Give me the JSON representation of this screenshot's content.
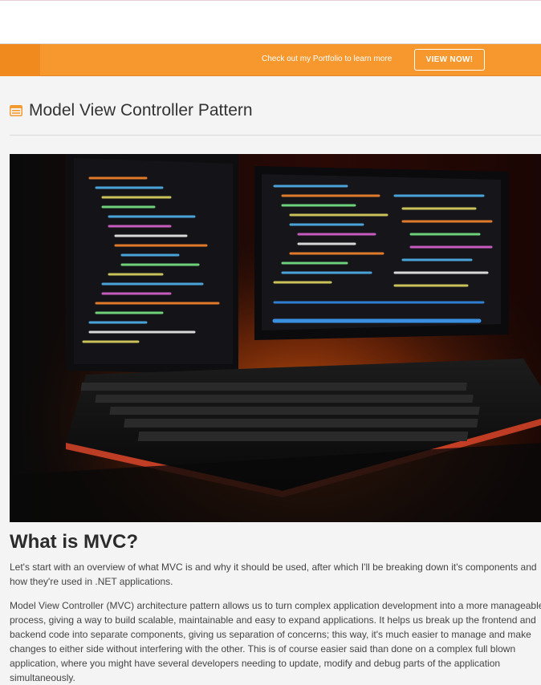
{
  "promo": {
    "text": "Check out my Portfolio to learn more",
    "button_label": "VIEW NOW!"
  },
  "article": {
    "title": "Model View Controller Pattern",
    "title_icon": "article-icon",
    "hero_image": "monitors-and-keyboard-with-code",
    "section_heading": "What is MVC?",
    "paragraphs": [
      "Let's start with an overview of what MVC is and why it should be used, after which I'll be breaking down it's components and how they're used in .NET applications.",
      "Model View Controller (MVC) architecture pattern allows us to turn complex application development into a more manageable process, giving a way to build scalable, maintainable and easy to expand applications. It helps us break up the frontend and backend code into separate components, giving us separation of concerns; this way, it's much easier to manage and make changes to either side without interfering with the other. This is of course easier said than done on a complex full blown application, where you might have several developers needing to update, modify and debug parts of the application simultaneously."
    ]
  },
  "colors": {
    "promo_bg": "#f7982e",
    "accent": "#f08a1f"
  }
}
